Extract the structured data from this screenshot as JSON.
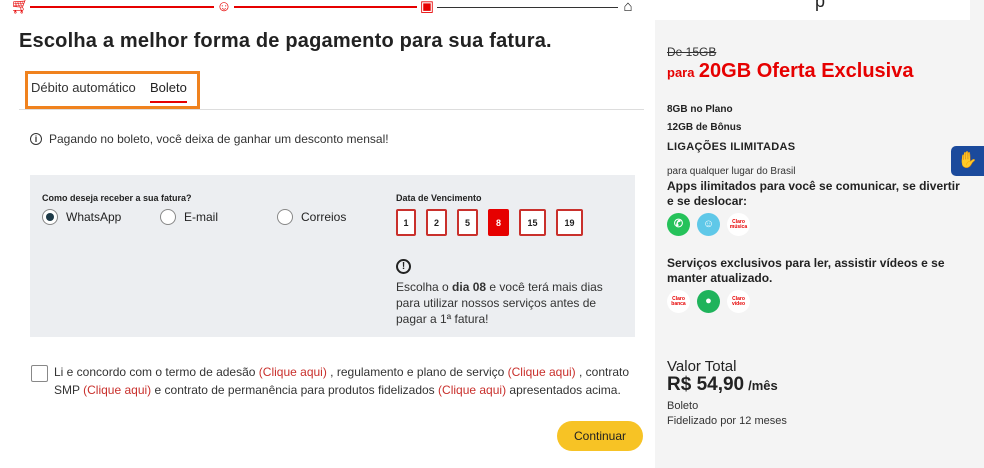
{
  "stepper": {
    "icons": [
      "cart-icon",
      "user-icon",
      "monitor-icon",
      "lock-icon"
    ]
  },
  "title": "Escolha a melhor forma de pagamento para sua fatura.",
  "tabs": [
    {
      "label": "Débito automático"
    },
    {
      "label": "Boleto",
      "active": true
    }
  ],
  "info_notice": "Pagando no boleto, você deixa de ganhar um desconto mensal!",
  "delivery": {
    "question": "Como deseja receber a sua fatura?",
    "options": [
      {
        "label": "WhatsApp",
        "selected": true
      },
      {
        "label": "E-mail",
        "selected": false
      },
      {
        "label": "Correios",
        "selected": false
      }
    ]
  },
  "due_date": {
    "label": "Data de Vencimento",
    "days": [
      "1",
      "2",
      "5",
      "8",
      "15",
      "19"
    ],
    "selected": "8",
    "tip_before": "Escolha o ",
    "tip_bold": "dia 08",
    "tip_after": " e você terá mais dias para utilizar nossos serviços antes de pagar a 1ª fatura!"
  },
  "terms": {
    "t1": "Li e concordo com o termo de adesão ",
    "l1": "(Clique aqui)",
    "t2": " , regulamento e plano de serviço ",
    "l2": "(Clique aqui)",
    "t3": " , contrato SMP ",
    "l3": "(Clique aqui)",
    "t4": " e contrato de permanência para produtos fidelizados ",
    "l4": "(Clique aqui)",
    "t5": " apresentados acima."
  },
  "continue_label": "Continuar",
  "summary": {
    "old_price": "De 15GB",
    "offer_prefix": "para",
    "offer_main": "20GB Oferta Exclusiva",
    "plan_data": "8GB no Plano",
    "bonus_data": "12GB de Bônus",
    "calls_title": "LIGAÇÕES ILIMITADAS",
    "calls_sub": "para qualquer lugar do Brasil",
    "apps_text": "Apps ilimitados para você se comunicar, se divertir e se deslocar:",
    "apps": [
      {
        "icon": "whatsapp-icon",
        "label": "✆"
      },
      {
        "icon": "waze-icon",
        "label": "☺"
      },
      {
        "icon": "claro-musica-icon",
        "label": "Claro música"
      }
    ],
    "services_text": "Serviços exclusivos para ler, assistir vídeos e se manter atualizado.",
    "services": [
      {
        "icon": "claro-banca-icon",
        "label": "Claro banca"
      },
      {
        "icon": "green-app-icon",
        "label": "●"
      },
      {
        "icon": "claro-video-icon",
        "label": "Claro vídeo"
      }
    ],
    "total_label": "Valor Total",
    "price": "R$ 54,90",
    "period": "/mês",
    "payment": "Boleto",
    "loyalty": "Fidelizado por 12 meses"
  },
  "colors": {
    "accent": "#e60000",
    "button": "#f7c325",
    "panel": "#eceef1",
    "highlight": "#f0821e"
  }
}
